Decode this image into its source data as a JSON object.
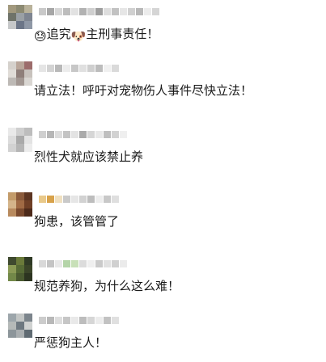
{
  "comments": [
    {
      "text": "追究",
      "emoji_before": "😓",
      "emoji_mid": "🐶",
      "text_after": "主刑事责任！"
    },
    {
      "text": "请立法！呼吁对宠物伤人事件尽快立法！"
    },
    {
      "text": "烈性犬就应该禁止养"
    },
    {
      "text": "狗患，该管管了"
    },
    {
      "text": "规范养狗，为什么这么难！"
    },
    {
      "text": "严惩狗主人！"
    }
  ],
  "avatar_palettes": [
    [
      "#a2997e",
      "#8c8a72",
      "#b9b29a",
      "#6f7369",
      "#9aa0a5",
      "#7e8591",
      "#c6c8c9",
      "#6b7587",
      "#8f98a6"
    ],
    [
      "#d5d1cc",
      "#b9a69a",
      "#9c6c6b",
      "#e0dcd7",
      "#8f7f7a",
      "#c8c2bd",
      "#bdb9b5",
      "#a29792",
      "#d9d6d2"
    ],
    [
      "#e9e9e9",
      "#cfcfcf",
      "#bdbdbd",
      "#dcdcdc",
      "#a9a9a9",
      "#e3e3e3",
      "#d2d2d2",
      "#b5b5b5",
      "#ececec"
    ],
    [
      "#c39b6a",
      "#8a5a3b",
      "#5c3522",
      "#d4b48a",
      "#a06a44",
      "#6f3f26",
      "#b88a5e",
      "#7a4a2e",
      "#4d2a1a"
    ],
    [
      "#3f4a2f",
      "#6a7a3a",
      "#2f3a25",
      "#8a9a55",
      "#566a35",
      "#3a4428",
      "#728848",
      "#4a5a30",
      "#2c3420"
    ],
    [
      "#9da6ab",
      "#c3c6c5",
      "#7c858c",
      "#b5b9b8",
      "#6e7880",
      "#d0d2d1",
      "#8c959a",
      "#a9aeb0",
      "#5f6a72"
    ]
  ],
  "username_palettes": [
    [
      "#c9c9c9",
      "#a6a6a6",
      "#d7d7d7",
      "#bdbdbd",
      "#e2e2e2",
      "#b2b2b2",
      "#cfcfcf",
      "#9e9e9e",
      "#dedede",
      "#c2c2c2",
      "#e6e6e6",
      "#d0d0d0",
      "#b8b8b8",
      "#ececec",
      "#d5d5d5"
    ],
    [
      "#e5e5e5",
      "#d3d3d3",
      "#b9b9b9",
      "#ececec",
      "#c7c7c7",
      "#e0e0e0",
      "#cfcfcf",
      "#bcbcbc",
      "#f0f0f0",
      "#dadada"
    ],
    [
      "#cfcfcf",
      "#b6b6b6",
      "#dcdcdc",
      "#c4c4c4",
      "#e3e3e3",
      "#aaaaaa",
      "#d6d6d6",
      "#e8e8e8",
      "#bfbfbf",
      "#d2d2d2",
      "#efefef"
    ],
    [
      "#e9c98a",
      "#d8a24a",
      "#f0e0c0",
      "#c9c9c9",
      "#e6e6e6",
      "#d2d2d2",
      "#bdbdbd",
      "#ededed",
      "#c8c8c8",
      "#dfdfdf"
    ],
    [
      "#d9d9d9",
      "#c4c4c4",
      "#e8e8e8",
      "#b4d4a8",
      "#c8e0b8",
      "#dcdcdc",
      "#efefef",
      "#cacaca",
      "#e1e1e1",
      "#d0d0d0",
      "#ebebeb"
    ],
    [
      "#cccccc",
      "#b8b8b8",
      "#dedede",
      "#c6c6c6",
      "#e9e9e9",
      "#bdbdbd",
      "#d6d6d6",
      "#ececec",
      "#c2c2c2",
      "#e0e0e0"
    ]
  ]
}
